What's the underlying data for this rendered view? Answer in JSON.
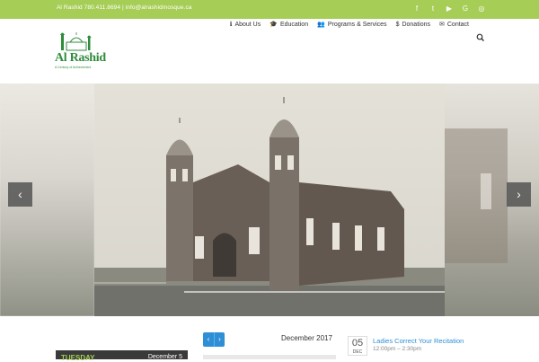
{
  "topbar": {
    "contact": "Al Rashid 780.411.8694 | info@alrashidmosque.ca",
    "social": [
      "f",
      "t",
      "yt",
      "g+",
      "ig"
    ]
  },
  "logo": {
    "name": "Al Rashid",
    "tagline": "A Century of Achievement"
  },
  "nav": {
    "items": [
      {
        "label": "About Us",
        "icon": "info-icon"
      },
      {
        "label": "Education",
        "icon": "graduation-cap-icon"
      },
      {
        "label": "Programs & Services",
        "icon": "users-icon"
      },
      {
        "label": "Donations",
        "icon": "dollar-icon"
      },
      {
        "label": "Contact",
        "icon": "envelope-icon"
      }
    ],
    "search_icon": "search-icon"
  },
  "slider": {
    "prev_icon": "chevron-left-icon",
    "next_icon": "chevron-right-icon"
  },
  "news": {
    "tag": "TUESDAY",
    "date": "December 5"
  },
  "calendar": {
    "month": "December 2017"
  },
  "event": {
    "day": "05",
    "month": "DEC",
    "title": "Ladies Correct Your Recitation",
    "time": "12:00pm – 2:30pm"
  },
  "colors": {
    "topbar": "#a6cd56",
    "brand_green": "#2f8c3c",
    "link_blue": "#2e8fd6"
  }
}
